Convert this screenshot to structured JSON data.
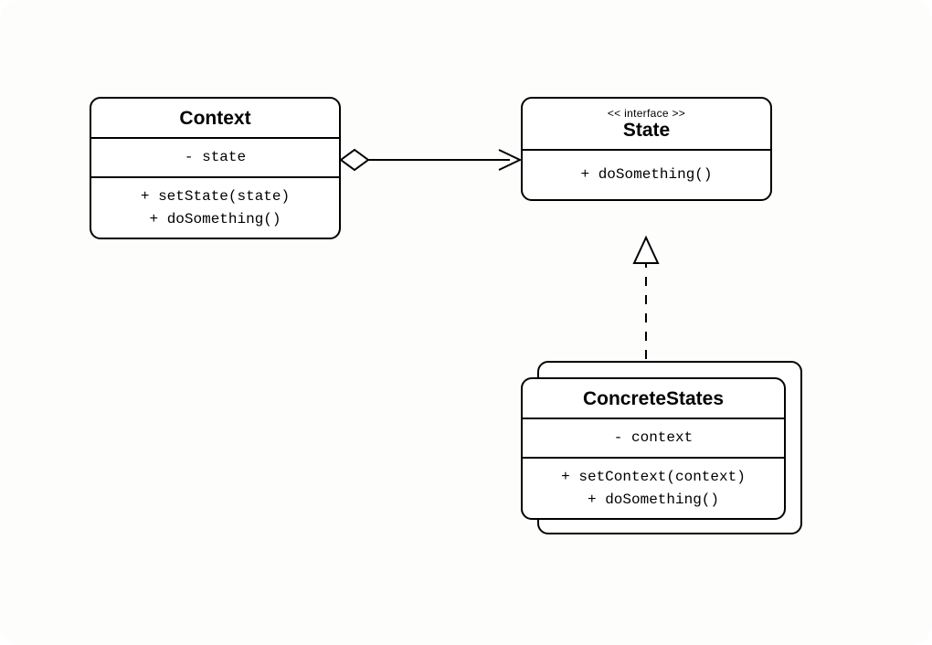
{
  "diagram": {
    "context": {
      "name": "Context",
      "attrs": {
        "state": "- state"
      },
      "ops": {
        "setState": "+ setState(state)",
        "doSomething": "+ doSomething()"
      }
    },
    "state": {
      "stereotype": "<< interface >>",
      "name": "State",
      "ops": {
        "doSomething": "+ doSomething()"
      }
    },
    "concrete": {
      "name": "ConcreteStates",
      "attrs": {
        "context": "- context"
      },
      "ops": {
        "setContext": "+ setContext(context)",
        "doSomething": "+ doSomething()"
      }
    }
  },
  "relations": {
    "aggregation": {
      "from": "Context",
      "to": "State",
      "kind": "aggregation-arrow"
    },
    "realization": {
      "from": "ConcreteStates",
      "to": "State",
      "kind": "realization-dashed-triangle"
    }
  }
}
